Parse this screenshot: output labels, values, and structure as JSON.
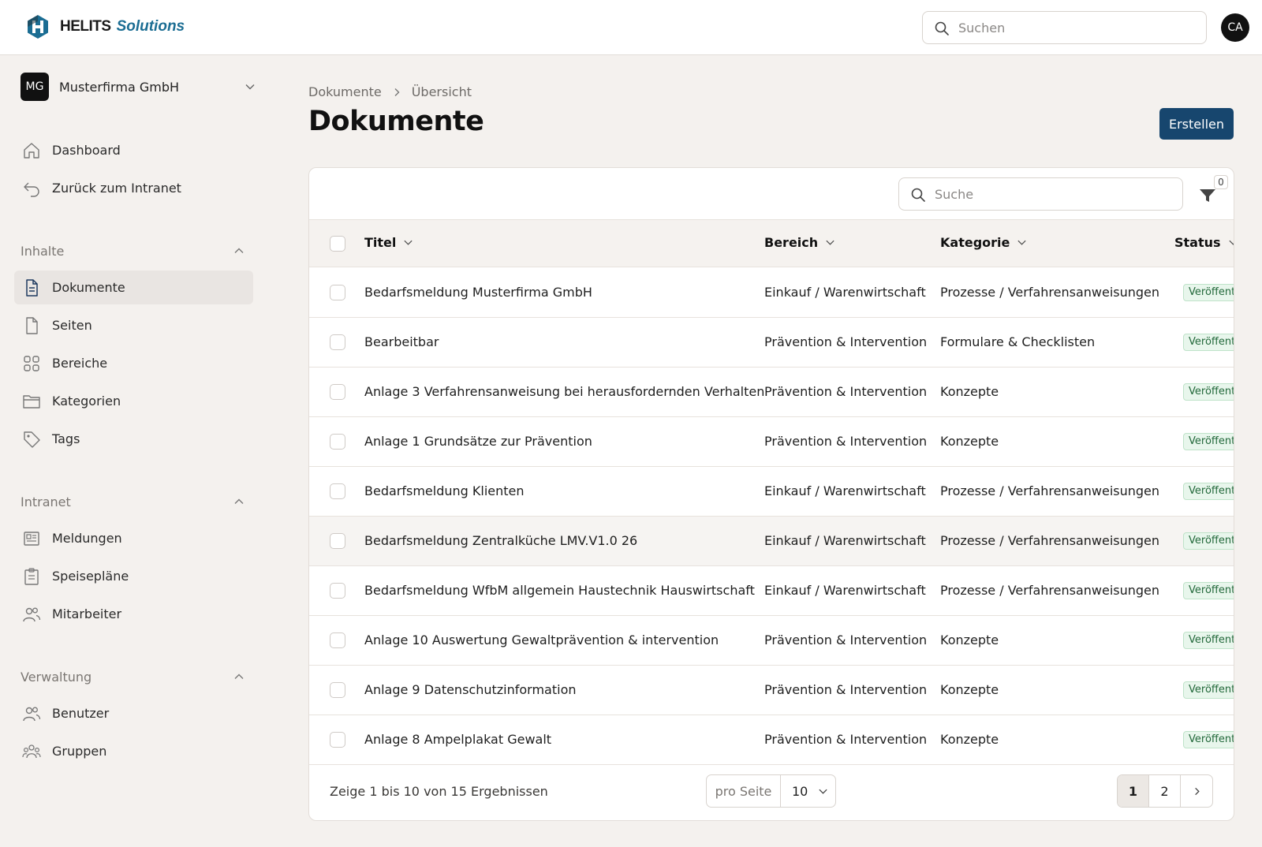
{
  "brand": {
    "name": "HELITS",
    "sub": "Solutions"
  },
  "header": {
    "search_placeholder": "Suchen",
    "user_initials": "CA"
  },
  "org": {
    "initials": "MG",
    "name": "Musterfirma GmbH"
  },
  "sidebar": {
    "top_items": [
      {
        "label": "Dashboard",
        "icon": "home-icon"
      },
      {
        "label": "Zurück zum Intranet",
        "icon": "back-arrow-icon"
      }
    ],
    "sections": [
      {
        "title": "Inhalte",
        "items": [
          {
            "label": "Dokumente",
            "icon": "document-icon",
            "active": true
          },
          {
            "label": "Seiten",
            "icon": "page-icon"
          },
          {
            "label": "Bereiche",
            "icon": "grid-icon"
          },
          {
            "label": "Kategorien",
            "icon": "folder-icon"
          },
          {
            "label": "Tags",
            "icon": "tag-icon"
          }
        ]
      },
      {
        "title": "Intranet",
        "items": [
          {
            "label": "Meldungen",
            "icon": "newspaper-icon"
          },
          {
            "label": "Speisepläne",
            "icon": "clipboard-icon"
          },
          {
            "label": "Mitarbeiter",
            "icon": "users-icon"
          }
        ]
      },
      {
        "title": "Verwaltung",
        "items": [
          {
            "label": "Benutzer",
            "icon": "users-icon"
          },
          {
            "label": "Gruppen",
            "icon": "group-icon"
          }
        ]
      }
    ]
  },
  "main": {
    "breadcrumb": [
      "Dokumente",
      "Übersicht"
    ],
    "title": "Dokumente",
    "create_label": "Erstellen"
  },
  "table": {
    "search_placeholder": "Suche",
    "filter_count": "0",
    "columns": [
      "Titel",
      "Bereich",
      "Kategorie",
      "Status"
    ],
    "rows": [
      {
        "title": "Bedarfsmeldung Musterfirma GmbH",
        "area": "Einkauf / Warenwirtschaft",
        "category": "Prozesse / Verfahrensanweisungen",
        "status": "Veröffentlicht"
      },
      {
        "title": "Bearbeitbar",
        "area": "Prävention & Intervention",
        "category": "Formulare & Checklisten",
        "status": "Veröffentlicht"
      },
      {
        "title": "Anlage 3 Verfahrensanweisung bei herausfordernden Verhalten",
        "area": "Prävention & Intervention",
        "category": "Konzepte",
        "status": "Veröffentlicht"
      },
      {
        "title": "Anlage 1 Grundsätze zur Prävention",
        "area": "Prävention & Intervention",
        "category": "Konzepte",
        "status": "Veröffentlicht"
      },
      {
        "title": "Bedarfsmeldung Klienten",
        "area": "Einkauf / Warenwirtschaft",
        "category": "Prozesse / Verfahrensanweisungen",
        "status": "Veröffentlicht"
      },
      {
        "title": "Bedarfsmeldung Zentralküche LMV.V1.0 26",
        "area": "Einkauf / Warenwirtschaft",
        "category": "Prozesse / Verfahrensanweisungen",
        "status": "Veröffentlicht"
      },
      {
        "title": "Bedarfsmeldung WfbM allgemein Haustechnik Hauswirtschaft",
        "area": "Einkauf / Warenwirtschaft",
        "category": "Prozesse / Verfahrensanweisungen",
        "status": "Veröffentlicht"
      },
      {
        "title": "Anlage 10 Auswertung Gewaltprävention & intervention",
        "area": "Prävention & Intervention",
        "category": "Konzepte",
        "status": "Veröffentlicht"
      },
      {
        "title": "Anlage 9 Datenschutzinformation",
        "area": "Prävention & Intervention",
        "category": "Konzepte",
        "status": "Veröffentlicht"
      },
      {
        "title": "Anlage 8 Ampelplakat Gewalt",
        "area": "Prävention & Intervention",
        "category": "Konzepte",
        "status": "Veröffentlicht"
      }
    ]
  },
  "footer": {
    "results_text": "Zeige 1 bis 10 von 15 Ergebnissen",
    "per_page_label": "pro Seite",
    "per_page_value": "10",
    "pages": [
      "1",
      "2"
    ],
    "current_page": "1"
  },
  "colors": {
    "primary": "#17466e",
    "brand_accent": "#1b6d93",
    "status_bg": "#e8f6ec",
    "status_text": "#22683a"
  }
}
